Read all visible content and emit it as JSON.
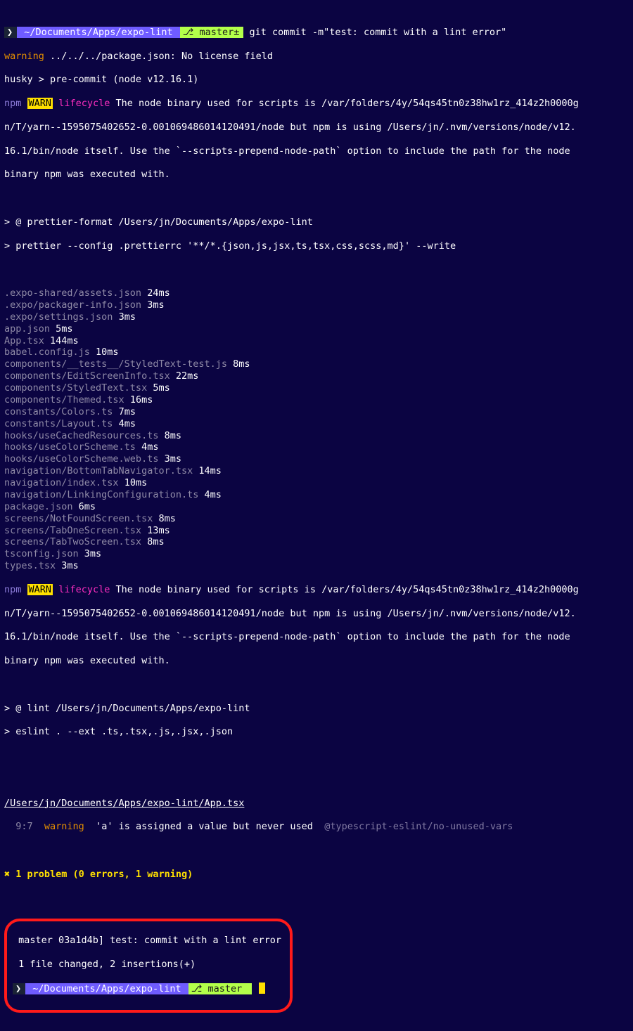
{
  "prompt1": {
    "chev": "❯",
    "path": "~/Documents/Apps/expo-lint",
    "branch_glyph": "⎇",
    "branch": "master±",
    "command": "git commit -m\"test: commit with a lint error\""
  },
  "warning_line": {
    "label": "warning",
    "text": "../../../package.json: No license field"
  },
  "husky_line": "husky > pre-commit (node v12.16.1)",
  "npm_warn": {
    "prefix": "npm",
    "badge": "WARN",
    "kind": "lifecycle",
    "body_l1": " The node binary used for scripts is /var/folders/4y/54qs45tn0z38hw1rz_414z2h0000g",
    "body_l2": "n/T/yarn--1595075402652-0.001069486014120491/node but npm is using /Users/jn/.nvm/versions/node/v12.",
    "body_l3": "16.1/bin/node itself. Use the `--scripts-prepend-node-path` option to include the path for the node",
    "body_l4": "binary npm was executed with."
  },
  "prettier_header": {
    "l1": "> @ prettier-format /Users/jn/Documents/Apps/expo-lint",
    "l2": "> prettier --config .prettierrc '**/*.{json,js,jsx,ts,tsx,css,scss,md}' --write"
  },
  "files": [
    {
      "name": ".expo-shared/assets.json",
      "time": "24ms"
    },
    {
      "name": ".expo/packager-info.json",
      "time": "3ms"
    },
    {
      "name": ".expo/settings.json",
      "time": "3ms"
    },
    {
      "name": "app.json",
      "time": "5ms"
    },
    {
      "name": "App.tsx",
      "time": "144ms"
    },
    {
      "name": "babel.config.js",
      "time": "10ms"
    },
    {
      "name": "components/__tests__/StyledText-test.js",
      "time": "8ms"
    },
    {
      "name": "components/EditScreenInfo.tsx",
      "time": "22ms"
    },
    {
      "name": "components/StyledText.tsx",
      "time": "5ms"
    },
    {
      "name": "components/Themed.tsx",
      "time": "16ms"
    },
    {
      "name": "constants/Colors.ts",
      "time": "7ms"
    },
    {
      "name": "constants/Layout.ts",
      "time": "4ms"
    },
    {
      "name": "hooks/useCachedResources.ts",
      "time": "8ms"
    },
    {
      "name": "hooks/useColorScheme.ts",
      "time": "4ms"
    },
    {
      "name": "hooks/useColorScheme.web.ts",
      "time": "3ms"
    },
    {
      "name": "navigation/BottomTabNavigator.tsx",
      "time": "14ms"
    },
    {
      "name": "navigation/index.tsx",
      "time": "10ms"
    },
    {
      "name": "navigation/LinkingConfiguration.ts",
      "time": "4ms"
    },
    {
      "name": "package.json",
      "time": "6ms"
    },
    {
      "name": "screens/NotFoundScreen.tsx",
      "time": "8ms"
    },
    {
      "name": "screens/TabOneScreen.tsx",
      "time": "13ms"
    },
    {
      "name": "screens/TabTwoScreen.tsx",
      "time": "8ms"
    },
    {
      "name": "tsconfig.json",
      "time": "3ms"
    },
    {
      "name": "types.tsx",
      "time": "3ms"
    }
  ],
  "lint_header": {
    "l1": "> @ lint /Users/jn/Documents/Apps/expo-lint",
    "l2": "> eslint . --ext .ts,.tsx,.js,.jsx,.json"
  },
  "eslint_file": "/Users/jn/Documents/Apps/expo-lint/App.tsx",
  "eslint_pos": "  9:7",
  "eslint_msg": "'a' is assigned a value but never used",
  "eslint_rule": "@typescript-eslint/no-unused-vars",
  "summary": "✖ 1 problem (0 errors, 1 warning)",
  "commit_l1": " master 03a1d4b] test: commit with a lint error",
  "commit_l2": " 1 file changed, 2 insertions(+)",
  "prompt2": {
    "chev": "❯",
    "path": "~/Documents/Apps/expo-lint",
    "branch_glyph": "⎇",
    "branch": "master"
  }
}
